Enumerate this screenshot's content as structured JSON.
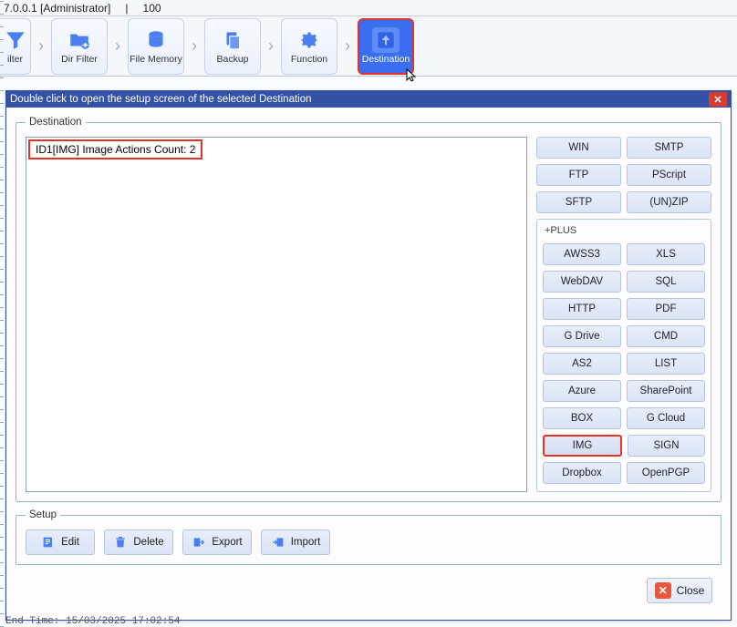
{
  "topstatus": {
    "version": "7.0.0.1 [Administrator]",
    "sep": "|",
    "value": "100"
  },
  "ribbon": {
    "filter": "ilter",
    "dirfilter": "Dir Filter",
    "filemem": "File Memory",
    "backup": "Backup",
    "function": "Function",
    "destination": "Destination"
  },
  "dialog": {
    "title": "Double click to open the setup screen of the selected Destination",
    "dest_legend": "Destination",
    "list_item": "ID1[IMG] Image Actions Count: 2",
    "plus_label": "+PLUS",
    "setup_legend": "Setup",
    "close_label": "Close"
  },
  "buttons_basic": {
    "win": "WIN",
    "smtp": "SMTP",
    "ftp": "FTP",
    "pscript": "PScript",
    "sftp": "SFTP",
    "unzip": "(UN)ZIP"
  },
  "buttons_plus": {
    "awss3": "AWSS3",
    "xls": "XLS",
    "webdav": "WebDAV",
    "sql": "SQL",
    "http": "HTTP",
    "pdf": "PDF",
    "gdrive": "G Drive",
    "cmd": "CMD",
    "as2": "AS2",
    "list": "LIST",
    "azure": "Azure",
    "sharepoint": "SharePoint",
    "box": "BOX",
    "gcloud": "G Cloud",
    "img": "IMG",
    "sign": "SIGN",
    "dropbox": "Dropbox",
    "openpgp": "OpenPGP"
  },
  "setup_buttons": {
    "edit": "Edit",
    "delete": "Delete",
    "export": "Export",
    "import": "Import"
  },
  "footer_log": "End Time: 15/03/2025 17:02:54"
}
